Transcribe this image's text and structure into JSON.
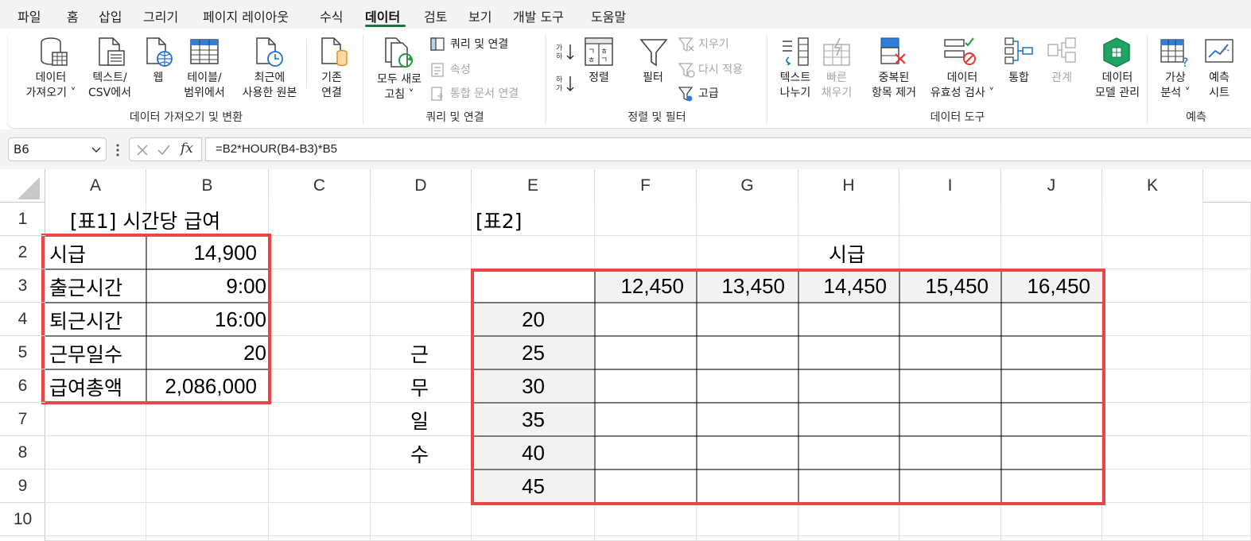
{
  "menu": {
    "tabs": [
      "파일",
      "홈",
      "삽입",
      "그리기",
      "페이지 레이아웃",
      "수식",
      "데이터",
      "검토",
      "보기",
      "개발 도구",
      "도움말"
    ],
    "active": "데이터"
  },
  "ribbon": {
    "get_data": {
      "group_label": "데이터 가져오기 및 변환",
      "get_data": [
        "데이터",
        "가져오기 ˅"
      ],
      "from_text": [
        "텍스트/",
        "CSV에서"
      ],
      "from_web": "웹",
      "from_table": [
        "테이블/",
        "범위에서"
      ],
      "recent_sources": [
        "최근에",
        "사용한 원본"
      ],
      "existing_connections": [
        "기존",
        "연결"
      ]
    },
    "queries": {
      "group_label": "쿼리 및 연결",
      "refresh_all": [
        "모두 새로",
        "고침 ˅"
      ],
      "queries_connections": "쿼리 및 연결",
      "properties": "속성",
      "edit_links": "통합 문서 연결"
    },
    "sort_filter": {
      "group_label": "정렬 및 필터",
      "sort": "정렬",
      "filter": "필터",
      "clear": "지우기",
      "reapply": "다시 적용",
      "advanced": "고급"
    },
    "data_tools": {
      "group_label": "데이터 도구",
      "text_to_columns": [
        "텍스트",
        "나누기"
      ],
      "flash_fill": [
        "빠른",
        "채우기"
      ],
      "remove_duplicates": [
        "중복된",
        "항목 제거"
      ],
      "data_validation": [
        "데이터",
        "유효성 검사 ˅"
      ],
      "consolidate": "통합",
      "relationships": "관계",
      "data_model": [
        "데이터",
        "모델 관리"
      ]
    },
    "forecast": {
      "group_label": "예측",
      "what_if": [
        "가상",
        "분석 ˅"
      ],
      "forecast_sheet": [
        "예측",
        "시트"
      ]
    }
  },
  "formula_bar": {
    "name_box": "B6",
    "formula": "=B2*HOUR(B4-B3)*B5"
  },
  "columns": [
    "A",
    "B",
    "C",
    "D",
    "E",
    "F",
    "G",
    "H",
    "I",
    "J",
    "K"
  ],
  "rows": [
    "1",
    "2",
    "3",
    "4",
    "5",
    "6",
    "7",
    "8",
    "9",
    "10"
  ],
  "table1": {
    "title": "[표1]  시간당 급여",
    "labels": [
      "시급",
      "출근시간",
      "퇴근시간",
      "근무일수",
      "급여총액"
    ],
    "values": [
      "14,900",
      "9:00",
      "16:00",
      "20",
      "2,086,000"
    ]
  },
  "table2": {
    "title": "[표2]",
    "col_title": "시급",
    "row_title": [
      "근",
      "무",
      "일",
      "수"
    ],
    "col_values": [
      "12,450",
      "13,450",
      "14,450",
      "15,450",
      "16,450"
    ],
    "row_values": [
      "20",
      "25",
      "30",
      "35",
      "40",
      "45"
    ]
  },
  "colors": {
    "highlight_border": "#ef4444",
    "accent": "#1e7145",
    "header_fill": "#f2f2f2"
  }
}
